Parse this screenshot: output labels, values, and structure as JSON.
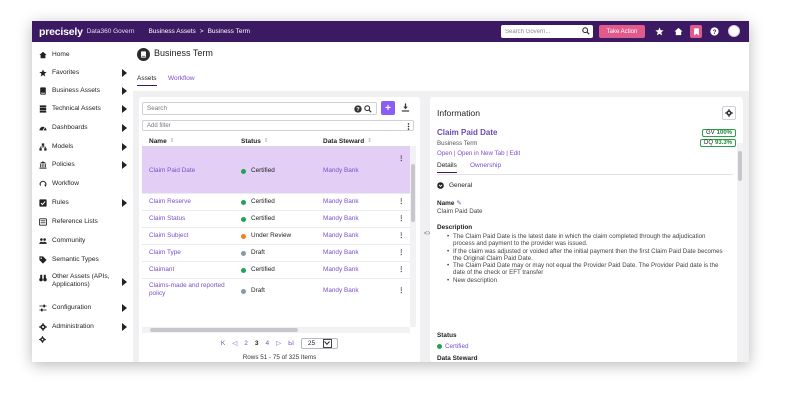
{
  "topbar": {
    "brand": "precisely",
    "product": "Data360 Govern",
    "breadcrumb": [
      "Business Assets",
      "Business Term"
    ],
    "breadcrumb_sep": ">",
    "search_placeholder": "Search Govern...",
    "take_action": "Take Action",
    "icons": [
      "star-icon",
      "home-icon",
      "bookmark-icon",
      "help-icon",
      "avatar"
    ]
  },
  "sidebar": {
    "items": [
      {
        "label": "Home",
        "icon": "home-icon",
        "submenu": false
      },
      {
        "label": "Favorites",
        "icon": "star-icon",
        "submenu": true
      },
      {
        "label": "Business Assets",
        "icon": "book-icon",
        "submenu": true
      },
      {
        "label": "Technical Assets",
        "icon": "server-icon",
        "submenu": true
      },
      {
        "label": "Dashboards",
        "icon": "dashboard-icon",
        "submenu": true
      },
      {
        "label": "Models",
        "icon": "hierarchy-icon",
        "submenu": true
      },
      {
        "label": "Policies",
        "icon": "bank-icon",
        "submenu": true
      },
      {
        "label": "Workflow",
        "icon": "workflow-icon",
        "submenu": false
      },
      {
        "label": "Rules",
        "icon": "rules-icon",
        "submenu": true
      },
      {
        "label": "Reference Lists",
        "icon": "list-icon",
        "submenu": false
      },
      {
        "label": "Community",
        "icon": "users-icon",
        "submenu": false
      },
      {
        "label": "Semantic Types",
        "icon": "tag-icon",
        "submenu": false
      },
      {
        "label": "Other Assets (APIs, Applications)",
        "icon": "binoculars-icon",
        "submenu": true
      },
      {
        "label": "Configuration",
        "icon": "sliders-icon",
        "submenu": true
      },
      {
        "label": "Administration",
        "icon": "gear-icon",
        "submenu": true
      }
    ]
  },
  "page": {
    "title": "Business Term",
    "tabs": [
      {
        "label": "Assets",
        "active": true
      },
      {
        "label": "Workflow",
        "active": false
      }
    ]
  },
  "grid": {
    "search_placeholder": "Search",
    "add_filter": "Add filter",
    "columns": [
      "Name",
      "Status",
      "Data Steward"
    ],
    "rows": [
      {
        "name": "Claim Paid Date",
        "status": "Certified",
        "status_color": "#22a352",
        "steward": "Mandy Bank",
        "selected": true
      },
      {
        "name": "Claim Reserve",
        "status": "Certified",
        "status_color": "#22a352",
        "steward": "Mandy Bank",
        "selected": false
      },
      {
        "name": "Claim Status",
        "status": "Certified",
        "status_color": "#22a352",
        "steward": "Mandy Bank",
        "selected": false
      },
      {
        "name": "Claim Subject",
        "status": "Under Review",
        "status_color": "#f07f1e",
        "steward": "Mandy Bank",
        "selected": false
      },
      {
        "name": "Claim Type",
        "status": "Draft",
        "status_color": "#8a97a8",
        "steward": "Mandy Bank",
        "selected": false
      },
      {
        "name": "Claimant",
        "status": "Certified",
        "status_color": "#22a352",
        "steward": "Mandy Bank",
        "selected": false
      },
      {
        "name": "Claims-made and reported policy",
        "status": "Draft",
        "status_color": "#8a97a8",
        "steward": "Mandy Bank",
        "selected": false
      }
    ],
    "pager": {
      "first": "K",
      "prev": "◁",
      "pages": [
        "2",
        "3",
        "4"
      ],
      "current": "3",
      "next": "▷",
      "last": "Ы",
      "page_size": "25"
    },
    "rows_info": "Rows 51 - 75 of 325 Items"
  },
  "info": {
    "title": "Information",
    "asset_name": "Claim Paid Date",
    "asset_type": "Business Term",
    "links": [
      "Open",
      "Open in New Tab",
      "Edit"
    ],
    "link_sep": " | ",
    "badges": [
      {
        "label": "GV",
        "value": "100%"
      },
      {
        "label": "DQ",
        "value": "93.3%"
      }
    ],
    "tabs": [
      {
        "label": "Details",
        "active": true
      },
      {
        "label": "Ownership",
        "active": false
      }
    ],
    "section": "General",
    "name_label": "Name",
    "name_value": "Claim Paid Date",
    "desc_label": "Description",
    "description": [
      "The Claim Paid Date is the latest date in which the claim completed through the adjudication process and payment to the provider was issued.",
      "If the claim was adjusted or voided after the initial payment then the first Claim Paid Date becomes the Original Claim Paid Date.",
      "The Claim Paid Date may or may not equal the Provider Paid Date. The Provider Paid date is the date of the check or EFT transfer",
      "New description"
    ],
    "status_label": "Status",
    "status_value": "Certified",
    "status_color": "#22a352",
    "steward_label": "Data Steward"
  }
}
